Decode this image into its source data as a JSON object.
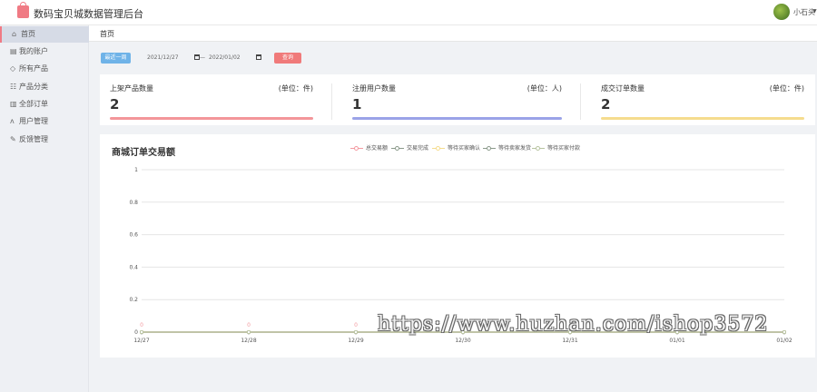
{
  "app": {
    "title": "数码宝贝城数据管理后台"
  },
  "user": {
    "name": "小石头",
    "caret": "▼"
  },
  "sidebar": {
    "items": [
      {
        "label": "首页",
        "icon": "⌂",
        "icon_name": "home-icon",
        "active": true
      },
      {
        "label": "我的账户",
        "icon": "▤",
        "icon_name": "account-icon",
        "active": false
      },
      {
        "label": "所有产品",
        "icon": "◇",
        "icon_name": "product-icon",
        "active": false
      },
      {
        "label": "产品分类",
        "icon": "☷",
        "icon_name": "category-icon",
        "active": false
      },
      {
        "label": "全部订单",
        "icon": "▥",
        "icon_name": "order-icon",
        "active": false
      },
      {
        "label": "用户管理",
        "icon": "ᴧ",
        "icon_name": "user-icon",
        "active": false
      },
      {
        "label": "反馈管理",
        "icon": "✎",
        "icon_name": "feedback-icon",
        "active": false
      }
    ]
  },
  "breadcrumb": {
    "current": "首页"
  },
  "filter": {
    "recent_label": "最近一周",
    "start_date": "2021/12/27",
    "separator": "—",
    "end_date": "2022/01/02",
    "query_label": "查询"
  },
  "stats": [
    {
      "title": "上架产品数量",
      "unit": "(单位：件)",
      "value": "2",
      "color": "#f3969a"
    },
    {
      "title": "注册用户数量",
      "unit": "(单位：人)",
      "value": "1",
      "color": "#9ba3e8"
    },
    {
      "title": "成交订单数量",
      "unit": "(单位：件)",
      "value": "2",
      "color": "#f5dc8e"
    }
  ],
  "chart": {
    "title": "商城订单交易额"
  },
  "chart_data": {
    "type": "line",
    "x": [
      "12/27",
      "12/28",
      "12/29",
      "12/30",
      "12/31",
      "01/01",
      "01/02"
    ],
    "series": [
      {
        "name": "总交易额",
        "color": "#f39aa0",
        "values": [
          0,
          0,
          0,
          0,
          0,
          0,
          0
        ]
      },
      {
        "name": "交易完成",
        "color": "#8a9a8a",
        "values": [
          0,
          0,
          0,
          0,
          0,
          0,
          0
        ]
      },
      {
        "name": "等待买家确认",
        "color": "#f5dc8e",
        "values": [
          0,
          0,
          0,
          0,
          0,
          0,
          0
        ]
      },
      {
        "name": "等待卖家发货",
        "color": "#8a9a8a",
        "values": [
          0,
          0,
          0,
          0,
          0,
          0,
          0
        ]
      },
      {
        "name": "等待买家付款",
        "color": "#b8c4a0",
        "values": [
          0,
          0,
          0,
          0,
          0,
          0,
          0
        ]
      }
    ],
    "ylim": [
      0,
      1
    ],
    "yticks": [
      "0",
      "0.2",
      "0.4",
      "0.6",
      "0.8",
      "1"
    ],
    "point_labels": [
      "0",
      "0",
      "0"
    ],
    "grid": true,
    "legend": "top"
  },
  "watermark": "https://www.huzhan.com/ishop3572"
}
